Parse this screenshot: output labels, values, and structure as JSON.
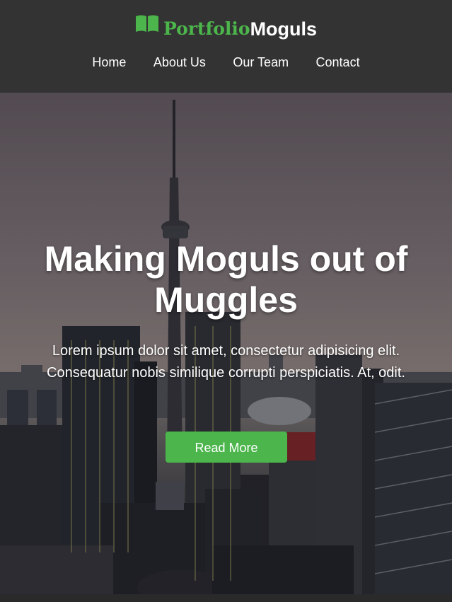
{
  "brand": {
    "part1": "Portfolio",
    "part2": "Moguls",
    "icon": "book-icon"
  },
  "nav": {
    "items": [
      {
        "label": "Home"
      },
      {
        "label": "About Us"
      },
      {
        "label": "Our Team"
      },
      {
        "label": "Contact"
      }
    ]
  },
  "hero": {
    "headline": "Making Moguls out of Muggles",
    "subtext": "Lorem ipsum dolor sit amet, consectetur adipisicing elit. Consequatur nobis similique corrupti perspiciatis. At, odit.",
    "button_label": "Read More"
  },
  "colors": {
    "header_bg": "#333333",
    "accent": "#4cb54c"
  }
}
